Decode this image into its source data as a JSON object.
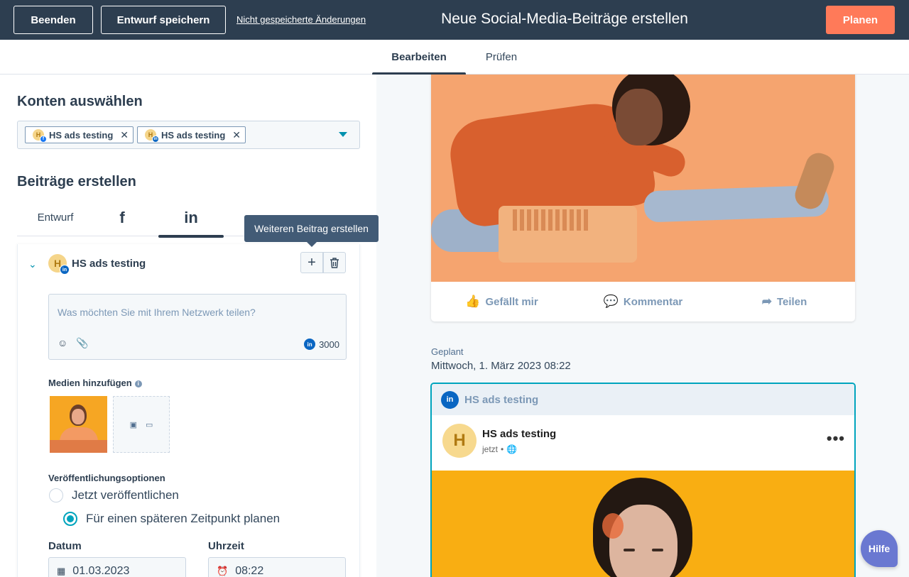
{
  "topbar": {
    "end_label": "Beenden",
    "save_draft_label": "Entwurf speichern",
    "unsaved_link": "Nicht gespeicherte Änderungen",
    "title": "Neue Social-Media-Beiträge erstellen",
    "plan_label": "Planen"
  },
  "tabs": [
    {
      "label": "Bearbeiten",
      "active": true
    },
    {
      "label": "Prüfen",
      "active": false
    }
  ],
  "accounts": {
    "heading": "Konten auswählen",
    "selected": [
      {
        "name": "HS ads testing",
        "avatar_letter": "H",
        "network": "facebook",
        "badge": "f"
      },
      {
        "name": "HS ads testing",
        "avatar_letter": "H",
        "network": "linkedin",
        "badge": "in"
      }
    ],
    "remove_glyph": "✕"
  },
  "posts": {
    "heading": "Beiträge erstellen",
    "network_tabs": [
      {
        "label": "Entwurf"
      },
      {
        "label": "f",
        "icon": "facebook-icon"
      },
      {
        "label": "in",
        "icon": "linkedin-icon",
        "active": true
      }
    ],
    "tooltip": "Weiteren Beitrag erstellen",
    "card": {
      "account_name": "HS ads testing",
      "avatar_letter": "H",
      "badge": "in",
      "add_glyph": "+",
      "delete_glyph": "🗑",
      "composer_placeholder": "Was möchten Sie mit Ihrem Netzwerk teilen?",
      "char_limit": "3000",
      "media_label": "Medien hinzufügen",
      "info_glyph": "i",
      "publish_label": "Veröffentlichungsoptionen",
      "option_now": "Jetzt veröffentlichen",
      "option_later": "Für einen späteren Zeitpunkt planen",
      "selected_option": "later",
      "date_label": "Datum",
      "date_value": "01.03.2023",
      "time_label": "Uhrzeit",
      "time_value": "08:22"
    }
  },
  "preview": {
    "fb_actions": [
      {
        "label": "Gefällt mir",
        "icon": "thumbs-up-icon",
        "glyph": "👍"
      },
      {
        "label": "Kommentar",
        "icon": "comment-icon",
        "glyph": "💬"
      },
      {
        "label": "Teilen",
        "icon": "share-icon",
        "glyph": "➦"
      }
    ],
    "scheduled_label": "Geplant",
    "scheduled_date": "Mittwoch, 1. März 2023 08:22",
    "li_card": {
      "header_badge": "in",
      "account_name": "HS ads testing",
      "author_name": "HS ads testing",
      "avatar_letter": "H",
      "meta_time": "jetzt",
      "meta_sep": "•",
      "more_glyph": "•••"
    }
  },
  "help_label": "Hilfe",
  "colors": {
    "topbar": "#2d3e50",
    "accent_orange": "#ff7a59",
    "accent_teal": "#00a4bd",
    "linkedin_blue": "#0a66c2",
    "help_purple": "#6a78d1"
  }
}
